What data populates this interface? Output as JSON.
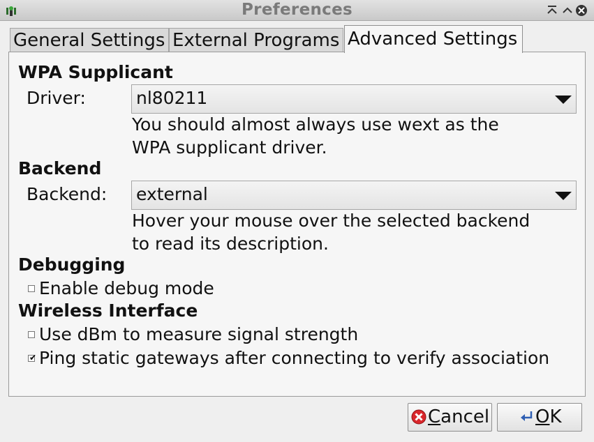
{
  "window": {
    "title": "Preferences"
  },
  "tabs": [
    {
      "label": "General Settings"
    },
    {
      "label": "External Programs"
    },
    {
      "label": "Advanced Settings",
      "active": true
    }
  ],
  "wpa": {
    "heading": "WPA Supplicant",
    "driver_label": "Driver:",
    "driver_value": "nl80211",
    "help_line1": "You should almost always use wext as the",
    "help_line2": "WPA supplicant driver."
  },
  "backend": {
    "heading": "Backend",
    "backend_label": "Backend:",
    "backend_value": "external",
    "help_line1": "Hover your mouse over the selected backend",
    "help_line2": "to read its description."
  },
  "debugging": {
    "heading": "Debugging",
    "debug_label": "Enable debug mode",
    "debug_checked": false
  },
  "wireless": {
    "heading": "Wireless Interface",
    "dbm_label": "Use dBm to measure signal strength",
    "dbm_checked": false,
    "ping_label": "Ping static gateways after connecting to verify association",
    "ping_checked": true
  },
  "buttons": {
    "cancel_mnemonic": "C",
    "cancel_rest": "ancel",
    "ok_mnemonic": "O",
    "ok_rest": "K"
  },
  "icons": {
    "app": "wireless-antenna-icon",
    "cancel": "cancel-icon",
    "ok": "ok-icon"
  },
  "colors": {
    "cancel_icon": "#d9262b",
    "ok_icon": "#2f5fb3"
  }
}
